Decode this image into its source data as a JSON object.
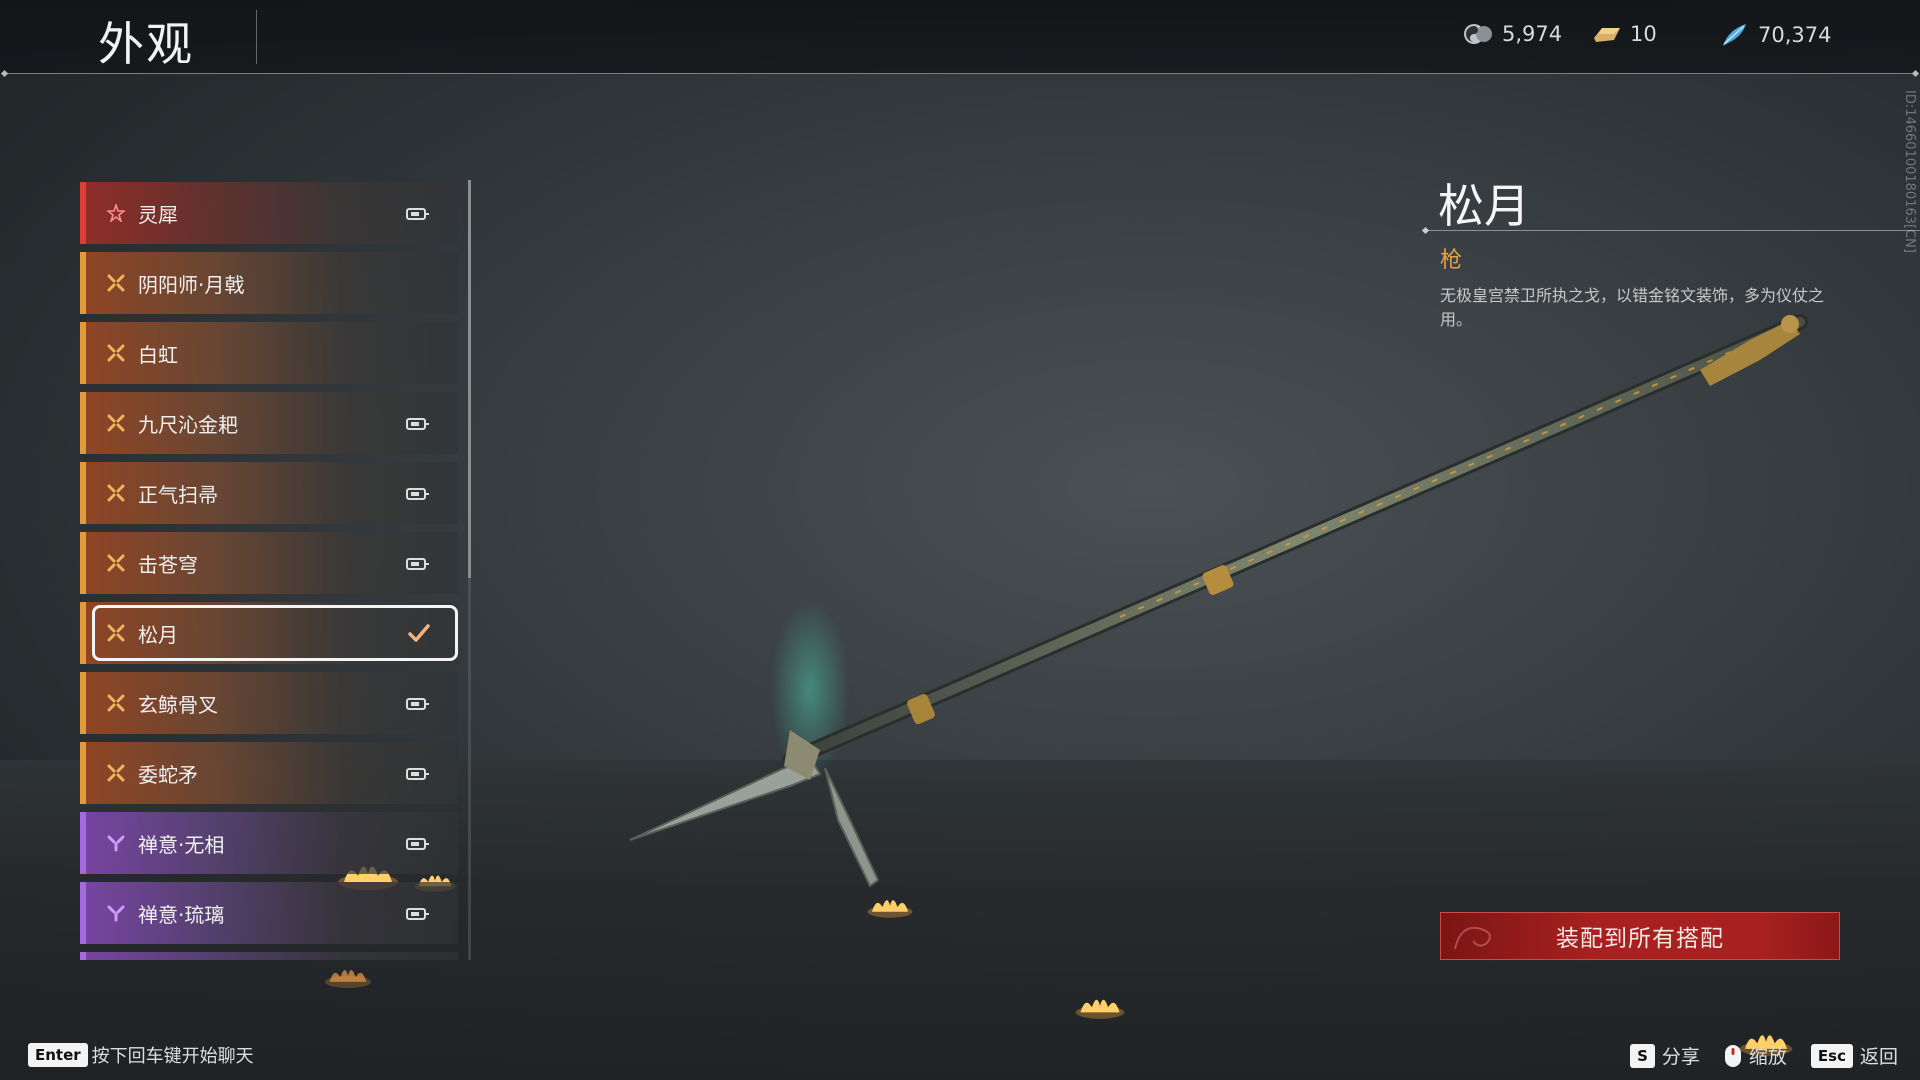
{
  "header": {
    "title": "外观",
    "currencies": [
      {
        "icon": "yin-yang-coin-icon",
        "value": "5,974"
      },
      {
        "icon": "gold-ingot-icon",
        "value": "10"
      },
      {
        "icon": "blue-feather-icon",
        "value": "70,374"
      }
    ]
  },
  "list": {
    "items": [
      {
        "label": "灵犀",
        "rarity": "red",
        "locked": true
      },
      {
        "label": "阴阳师·月戟",
        "rarity": "gold",
        "locked": false
      },
      {
        "label": "白虹",
        "rarity": "gold",
        "locked": false
      },
      {
        "label": "九尺沁金耙",
        "rarity": "gold",
        "locked": true
      },
      {
        "label": "正气扫帚",
        "rarity": "gold",
        "locked": true
      },
      {
        "label": "击苍穹",
        "rarity": "gold",
        "locked": true
      },
      {
        "label": "松月",
        "rarity": "gold",
        "locked": false,
        "selected": true
      },
      {
        "label": "玄鲸骨叉",
        "rarity": "gold",
        "locked": true
      },
      {
        "label": "委蛇矛",
        "rarity": "gold",
        "locked": true
      },
      {
        "label": "禅意·无相",
        "rarity": "purple",
        "locked": true
      },
      {
        "label": "禅意·琉璃",
        "rarity": "purple",
        "locked": true
      }
    ]
  },
  "detail": {
    "name": "松月",
    "type": "枪",
    "description": "无极皇宫禁卫所执之戈，以错金铭文装饰，多为仪仗之用。",
    "id": "ID:1466010018016­3[CN]",
    "equip_button": "装配到所有搭配"
  },
  "footer": {
    "chat_key": "Enter",
    "chat_hint": "按下回车键开始聊天",
    "controls": [
      {
        "key": "S",
        "label": "分享"
      },
      {
        "key": "mouse-icon",
        "label": "缩放"
      },
      {
        "key": "Esc",
        "label": "返回"
      }
    ]
  },
  "colors": {
    "red_rarity": "#e03c34",
    "gold_rarity": "#e39a3a",
    "purple_rarity": "#a56ae0",
    "type_text": "#e1a24a",
    "equip_button": "#a82120"
  }
}
